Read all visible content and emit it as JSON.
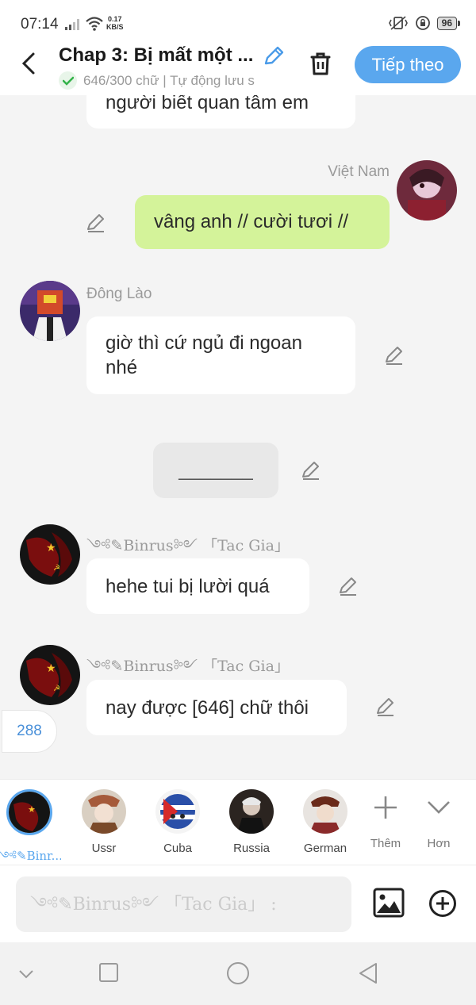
{
  "status_bar": {
    "time": "07:14",
    "speed_value": "0.17",
    "speed_unit": "KB/S",
    "battery": "96"
  },
  "header": {
    "title": "Chap 3: Bị mất một ...",
    "subtitle": "646/300 chữ | Tự động lưu s",
    "next_label": "Tiếp theo"
  },
  "chat": {
    "messages": [
      {
        "text": "người biết quan tâm em"
      },
      {
        "sender": "Việt Nam",
        "text": "vâng anh // cười tươi //"
      },
      {
        "sender": "Đông Lào",
        "text": "giờ thì cứ ngủ đi ngoan nhé"
      },
      {
        "divider": "_______"
      },
      {
        "sender": "༺✎Binrus༻ 「Tac Gia」",
        "text": "hehe tui bị lười quá"
      },
      {
        "sender": "༺✎Binrus༻ 「Tac Gia」",
        "text": "nay được [646] chữ thôi"
      }
    ],
    "counter": "288"
  },
  "characters": {
    "items": [
      {
        "name": "༺✎Binr..."
      },
      {
        "name": "Ussr"
      },
      {
        "name": "Cuba"
      },
      {
        "name": "Russia"
      },
      {
        "name": "German"
      }
    ],
    "add_label": "Thêm",
    "more_label": "Hơn"
  },
  "composer": {
    "placeholder": "༺✎Binrus༻ 「Tac Gia」 :"
  },
  "colors": {
    "accent": "#5aa7ee",
    "right_bubble": "#d4f39a",
    "background": "#f4f4f4"
  }
}
